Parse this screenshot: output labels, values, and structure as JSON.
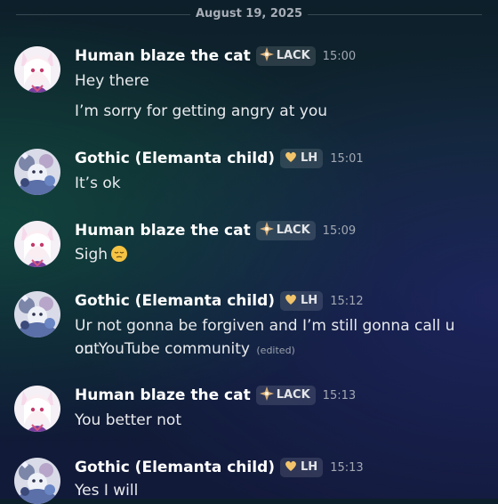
{
  "date_divider": "August 19, 2025",
  "users": {
    "blaze": {
      "name": "Human blaze the cat",
      "tag": "LACK",
      "tag_icon": "compass-star-icon"
    },
    "gothic": {
      "name": "Gothic (Elemanta child)",
      "tag": "LH",
      "tag_icon": "heart-icon"
    }
  },
  "messages": [
    {
      "time": "15:00",
      "lines": [
        "Hey there",
        "I’m sorry for getting angry at you"
      ]
    },
    {
      "time": "15:01",
      "lines": [
        "It’s ok"
      ]
    },
    {
      "time": "15:09",
      "lines": [
        "Sigh"
      ],
      "emoji": "pensive-face-emoji"
    },
    {
      "time": "15:12",
      "lines": [
        "Ur not gonna be forgiven and I’m still gonna call u out",
        "on YouTube community"
      ],
      "edited": "(edited)"
    },
    {
      "time": "15:13",
      "lines": [
        "You better not"
      ]
    },
    {
      "time": "15:13",
      "lines": [
        "Yes I will"
      ]
    }
  ],
  "colors": {
    "tag_bg": "#3a3f4a",
    "text": "#e8eaed",
    "muted": "#a2a8b3",
    "heart": "#f0c070"
  }
}
